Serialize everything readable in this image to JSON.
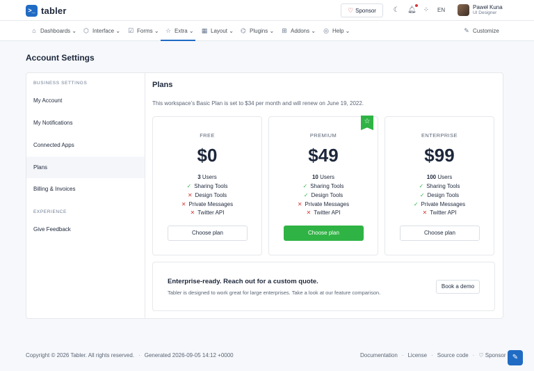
{
  "brand": {
    "name": "tabler",
    "mark": ">_",
    "accent": "#206bc4"
  },
  "header": {
    "sponsor_label": "Sponsor",
    "language": "EN",
    "user": {
      "name": "Paweł Kuna",
      "role": "UI Designer"
    }
  },
  "nav": [
    {
      "label": "Dashboards",
      "icon": "home-icon"
    },
    {
      "label": "Interface",
      "icon": "package-icon"
    },
    {
      "label": "Forms",
      "icon": "checkbox-icon"
    },
    {
      "label": "Extra",
      "icon": "star-icon"
    },
    {
      "label": "Layout",
      "icon": "layout-icon"
    },
    {
      "label": "Plugins",
      "icon": "puzzle-icon"
    },
    {
      "label": "Addons",
      "icon": "gift-icon"
    },
    {
      "label": "Help",
      "icon": "lifebuoy-icon"
    },
    {
      "label": "Customize",
      "icon": "brush-icon"
    }
  ],
  "page": {
    "title": "Account Settings"
  },
  "sidebar": {
    "business_heading": "Business settings",
    "items": [
      "My Account",
      "My Notifications",
      "Connected Apps",
      "Plans",
      "Billing & Invoices"
    ],
    "experience_heading": "Experience",
    "experience_items": [
      "Give Feedback"
    ]
  },
  "plans": {
    "title": "Plans",
    "description": "This workspace’s Basic Plan is set to $34 per month and will renew on June 19, 2022.",
    "cards": [
      {
        "name": "Free",
        "price": "$0",
        "users_count": "3",
        "users_label": "Users",
        "features": [
          {
            "label": "Sharing Tools",
            "included": true
          },
          {
            "label": "Design Tools",
            "included": false
          },
          {
            "label": "Private Messages",
            "included": false
          },
          {
            "label": "Twitter API",
            "included": false
          }
        ],
        "button": "Choose plan"
      },
      {
        "name": "Premium",
        "price": "$49",
        "users_count": "10",
        "users_label": "Users",
        "features": [
          {
            "label": "Sharing Tools",
            "included": true
          },
          {
            "label": "Design Tools",
            "included": true
          },
          {
            "label": "Private Messages",
            "included": false
          },
          {
            "label": "Twitter API",
            "included": false
          }
        ],
        "button": "Choose plan"
      },
      {
        "name": "Enterprise",
        "price": "$99",
        "users_count": "100",
        "users_label": "Users",
        "features": [
          {
            "label": "Sharing Tools",
            "included": true
          },
          {
            "label": "Design Tools",
            "included": true
          },
          {
            "label": "Private Messages",
            "included": true
          },
          {
            "label": "Twitter API",
            "included": false
          }
        ],
        "button": "Choose plan"
      }
    ],
    "enterprise": {
      "title": "Enterprise-ready. Reach out for a custom quote.",
      "description": "Tabler is designed to work great for large enterprises. Take a look at our feature comparison.",
      "button": "Book a demo"
    }
  },
  "footer": {
    "copyright": "Copyright © 2026 Tabler. All rights reserved.",
    "generated": "Generated 2026-09-05 14:12 +0000",
    "links": [
      "Documentation",
      "License",
      "Source code",
      "Sponsor"
    ]
  },
  "colors": {
    "success": "#2fb344",
    "danger": "#d63939",
    "primary": "#206bc4"
  }
}
